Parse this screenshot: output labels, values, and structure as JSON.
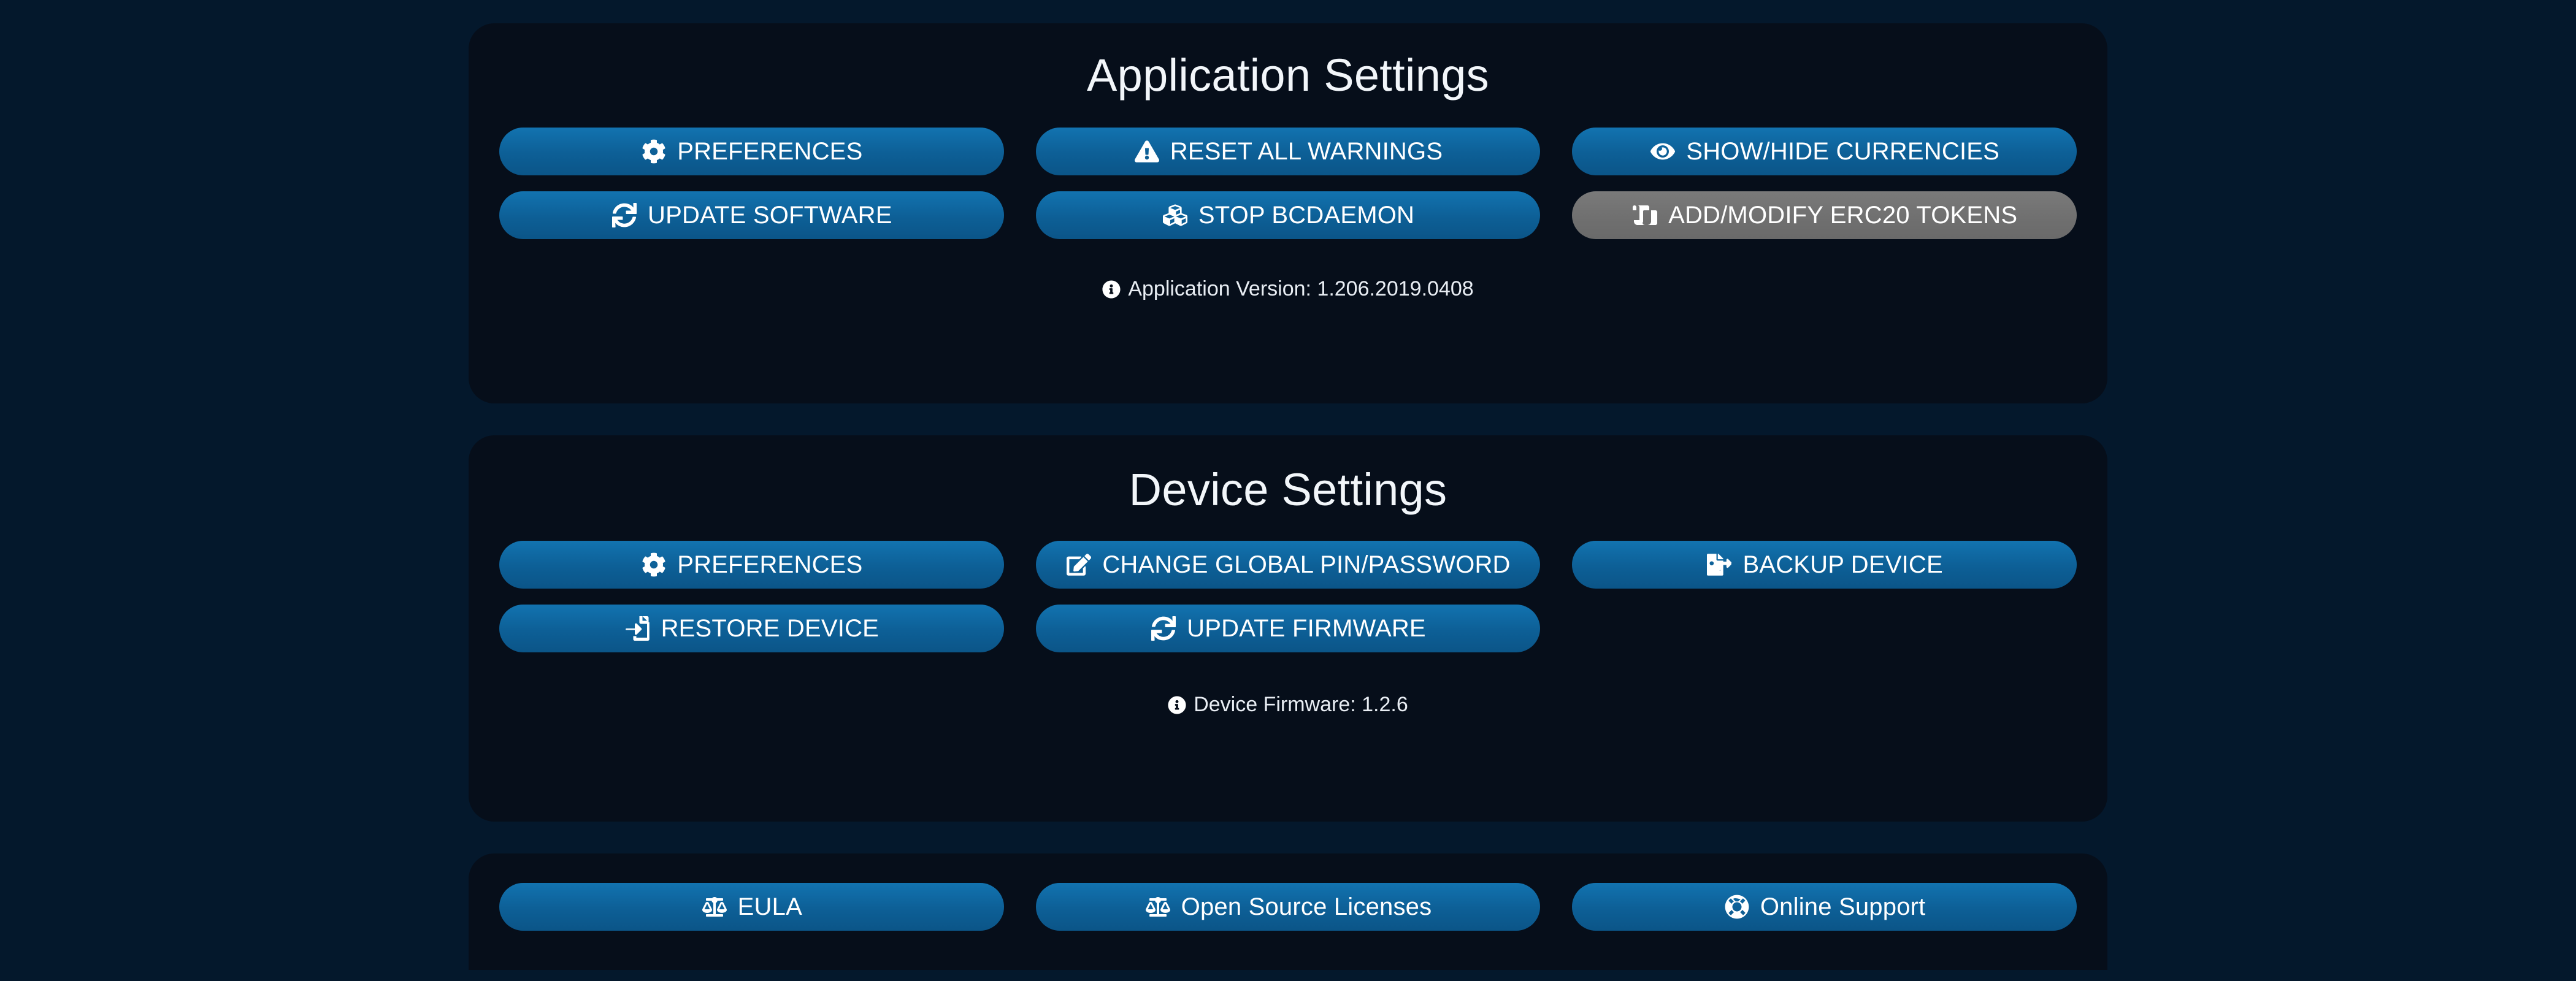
{
  "theme": {
    "background": "#04182c",
    "panel_background": "#060e1a",
    "button_accent": "#0d5f96",
    "button_disabled": "#6f6f6f",
    "text_color": "#ffffff"
  },
  "application_settings": {
    "title": "Application Settings",
    "buttons": [
      {
        "label": "PREFERENCES",
        "icon": "gear-icon",
        "disabled": false
      },
      {
        "label": "RESET ALL WARNINGS",
        "icon": "warning-triangle-icon",
        "disabled": false
      },
      {
        "label": "SHOW/HIDE CURRENCIES",
        "icon": "eye-icon",
        "disabled": false
      },
      {
        "label": "UPDATE SOFTWARE",
        "icon": "sync-icon",
        "disabled": false
      },
      {
        "label": "STOP BCDAEMON",
        "icon": "cubes-icon",
        "disabled": false
      },
      {
        "label": "ADD/MODIFY ERC20 TOKENS",
        "icon": "scroll-icon",
        "disabled": true
      }
    ],
    "version_icon": "info-circle-icon",
    "version_text": "Application Version: 1.206.2019.0408"
  },
  "device_settings": {
    "title": "Device Settings",
    "buttons": [
      {
        "label": "PREFERENCES",
        "icon": "gear-icon",
        "disabled": false
      },
      {
        "label": "CHANGE GLOBAL PIN/PASSWORD",
        "icon": "edit-square-icon",
        "disabled": false
      },
      {
        "label": "BACKUP DEVICE",
        "icon": "file-export-icon",
        "disabled": false
      },
      {
        "label": "RESTORE DEVICE",
        "icon": "file-import-icon",
        "disabled": false
      },
      {
        "label": "UPDATE FIRMWARE",
        "icon": "sync-icon",
        "disabled": false
      }
    ],
    "firmware_icon": "info-circle-icon",
    "firmware_text": "Device Firmware: 1.2.6"
  },
  "legal": {
    "buttons": [
      {
        "label": "EULA",
        "icon": "balance-scale-icon",
        "disabled": false
      },
      {
        "label": "Open Source Licenses",
        "icon": "balance-scale-icon",
        "disabled": false
      },
      {
        "label": "Online Support",
        "icon": "life-ring-icon",
        "disabled": false
      }
    ]
  }
}
